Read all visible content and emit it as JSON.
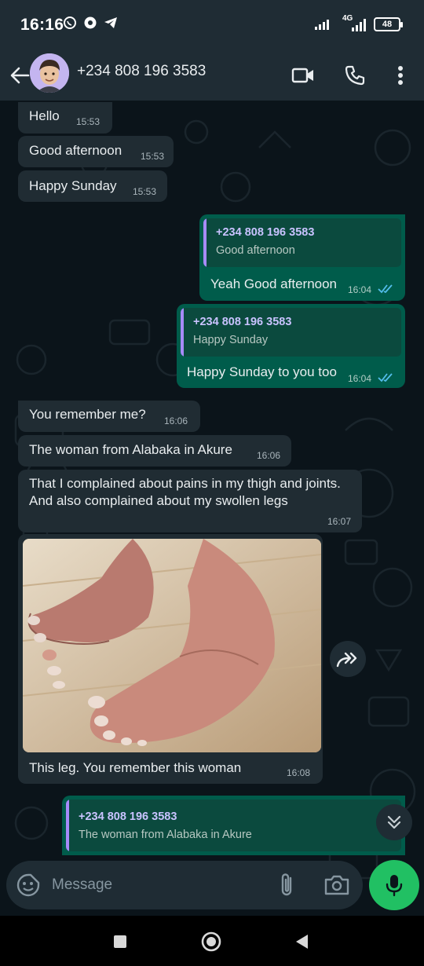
{
  "status": {
    "time": "16:16",
    "network": "4G",
    "battery": "48"
  },
  "header": {
    "contact": "+234 808 196 3583"
  },
  "messages": [
    {
      "dir": "in",
      "text": "Hello",
      "time": "15:53"
    },
    {
      "dir": "in",
      "text": "Good afternoon",
      "time": "15:53"
    },
    {
      "dir": "in",
      "text": "Happy Sunday",
      "time": "15:53"
    },
    {
      "dir": "out",
      "quote_name": "+234 808 196 3583",
      "quote_text": "Good afternoon",
      "text": "Yeah Good afternoon",
      "time": "16:04"
    },
    {
      "dir": "out",
      "quote_name": "+234 808 196 3583",
      "quote_text": "Happy Sunday",
      "text": "Happy Sunday to you too",
      "time": "16:04"
    },
    {
      "dir": "in",
      "text": "You remember me?",
      "time": "16:06"
    },
    {
      "dir": "in",
      "text": "The woman from Alabaka in Akure",
      "time": "16:06"
    },
    {
      "dir": "in",
      "text": "That I complained about pains in my thigh and joints. And also complained about my swollen legs",
      "time": "16:07"
    },
    {
      "dir": "in",
      "caption": "This leg. You remember this woman",
      "time": "16:08"
    },
    {
      "dir": "out",
      "quote_name": "+234 808 196 3583",
      "quote_text": "The woman from Alabaka in Akure"
    }
  ],
  "composer": {
    "placeholder": "Message"
  },
  "colors": {
    "background": "#0b141a",
    "incoming": "#202c33",
    "outgoing": "#005c4b",
    "accent": "#21c063",
    "read_ticks": "#53bdeb"
  }
}
